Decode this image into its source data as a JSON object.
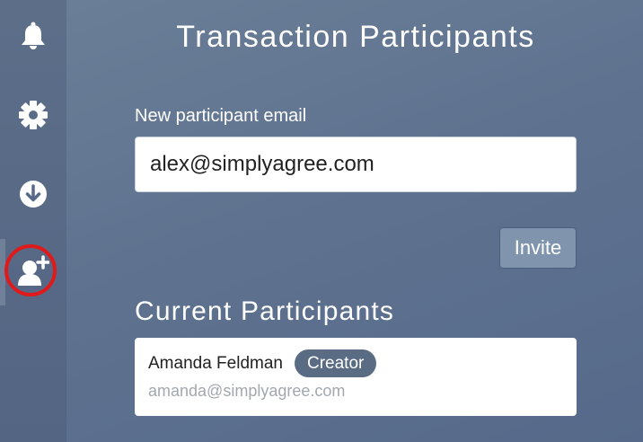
{
  "sidebar": {
    "items": [
      {
        "icon": "bell-icon"
      },
      {
        "icon": "gear-icon"
      },
      {
        "icon": "download-icon"
      },
      {
        "icon": "add-user-icon"
      }
    ],
    "highlight_color": "#e01a1a"
  },
  "page": {
    "title": "Transaction Participants"
  },
  "invite": {
    "label": "New participant email",
    "email_value": "alex@simplyagree.com",
    "button_label": "Invite"
  },
  "participants": {
    "section_title": "Current Participants",
    "items": [
      {
        "name": "Amanda Feldman",
        "role": "Creator",
        "email": "amanda@simplyagree.com"
      }
    ]
  },
  "colors": {
    "background": "#5f7390",
    "badge": "#5a6b84",
    "button": "#8095ad"
  }
}
